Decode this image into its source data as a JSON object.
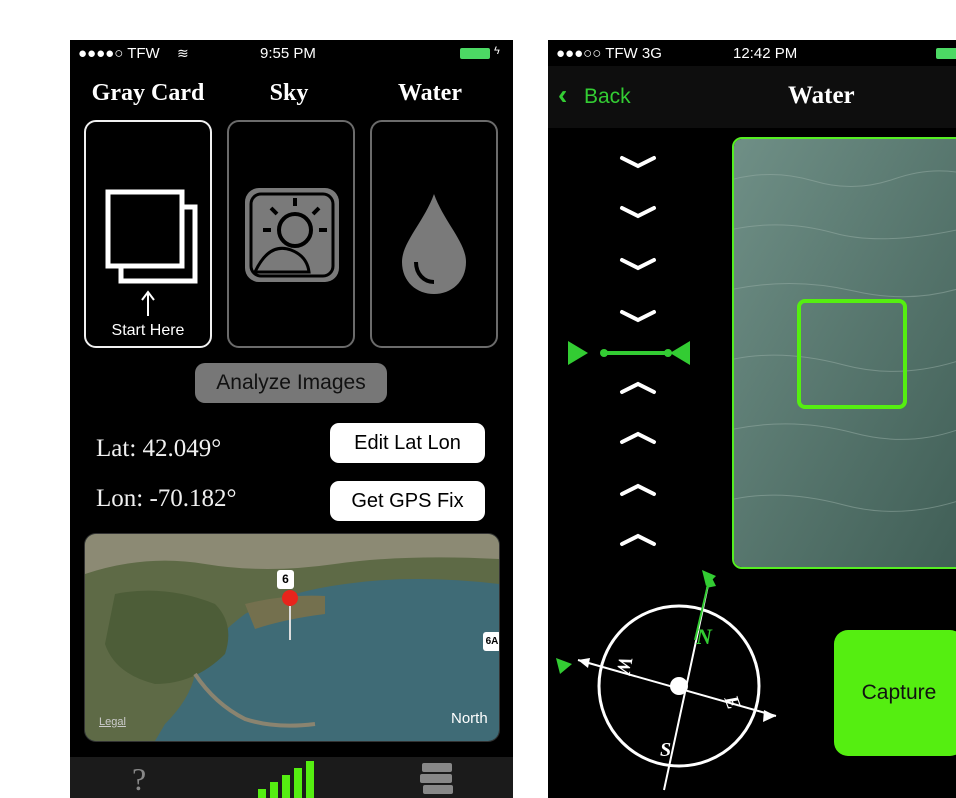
{
  "left_screen": {
    "status": {
      "carrier": "●●●●○ TFW",
      "time": "9:55 PM"
    },
    "categories": [
      {
        "label": "Gray Card",
        "sublabel": "Start Here"
      },
      {
        "label": "Sky"
      },
      {
        "label": "Water"
      }
    ],
    "analyze_button": "Analyze Images",
    "lat": "Lat: 42.049°",
    "lon": "Lon: -70.182°",
    "edit_button": "Edit Lat Lon",
    "gps_button": "Get GPS Fix",
    "map": {
      "route_label": "6",
      "route_label_2": "6A",
      "legal": "Legal",
      "north": "North"
    },
    "tabs": {
      "help": "?"
    }
  },
  "right_screen": {
    "status": {
      "carrier": "●●●○○ TFW  3G",
      "time": "12:42 PM"
    },
    "back_label": "Back",
    "title": "Water",
    "compass": {
      "n": "N",
      "e": "E",
      "s": "S",
      "w": "W"
    },
    "capture_button": "Capture"
  },
  "colors": {
    "accent_green": "#33cc33",
    "bright_green": "#55ee11",
    "battery_green": "#4cd964"
  }
}
